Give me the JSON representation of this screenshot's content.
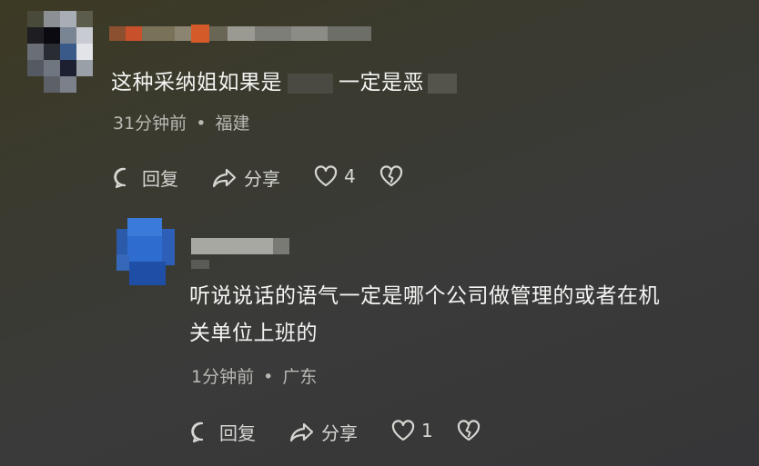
{
  "comments": [
    {
      "text_before": "这种采纳姐如果是",
      "text_after": "一定是恶",
      "time": "31分钟前",
      "location": "福建",
      "actions": {
        "reply": "回复",
        "share": "分享",
        "likes": "4"
      }
    },
    {
      "text_line1": "听说说话的语气一定是哪个公司做管理的或者在机",
      "text_line2": "关单位上班的",
      "time": "1分钟前",
      "location": "广东",
      "actions": {
        "reply": "回复",
        "share": "分享",
        "likes": "1"
      }
    }
  ],
  "separator": "•",
  "icons": [
    "reply-bubble-icon",
    "share-arrow-icon",
    "heart-icon",
    "broken-heart-icon"
  ],
  "colors": {
    "text": "#f4f4f2",
    "meta": "#b9b9b4",
    "icon": "#d6d6d2"
  }
}
